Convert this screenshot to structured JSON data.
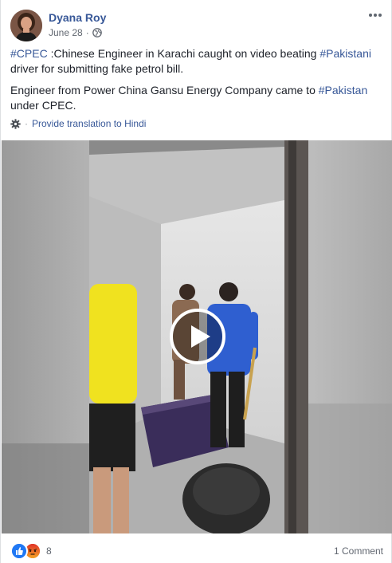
{
  "post": {
    "author": "Dyana Roy",
    "date": "June 28",
    "separator": "·",
    "body": {
      "p1": {
        "tag1": "#CPEC",
        "text1": " :Chinese Engineer in Karachi caught on video beating ",
        "tag2": "#Pakistani",
        "text2": " driver for submitting fake petrol bill."
      },
      "p2": {
        "text1": "Engineer from Power China Gansu Energy Company came to ",
        "tag1": "#Pakistan",
        "text2": " under CPEC."
      }
    },
    "translate": {
      "dot": "·",
      "label": "Provide translation to Hindi"
    },
    "video": {
      "play_icon": "play-icon"
    },
    "footer": {
      "reaction_count": "8",
      "comments": "1 Comment"
    }
  },
  "colors": {
    "link": "#385898",
    "meta": "#616770",
    "like": "#2078f4",
    "angry": "#e8571d"
  },
  "icons": {
    "globe": "globe-icon",
    "more": "more-options-icon",
    "gear": "gear-icon",
    "like": "like-reaction-icon",
    "angry": "angry-reaction-icon"
  }
}
